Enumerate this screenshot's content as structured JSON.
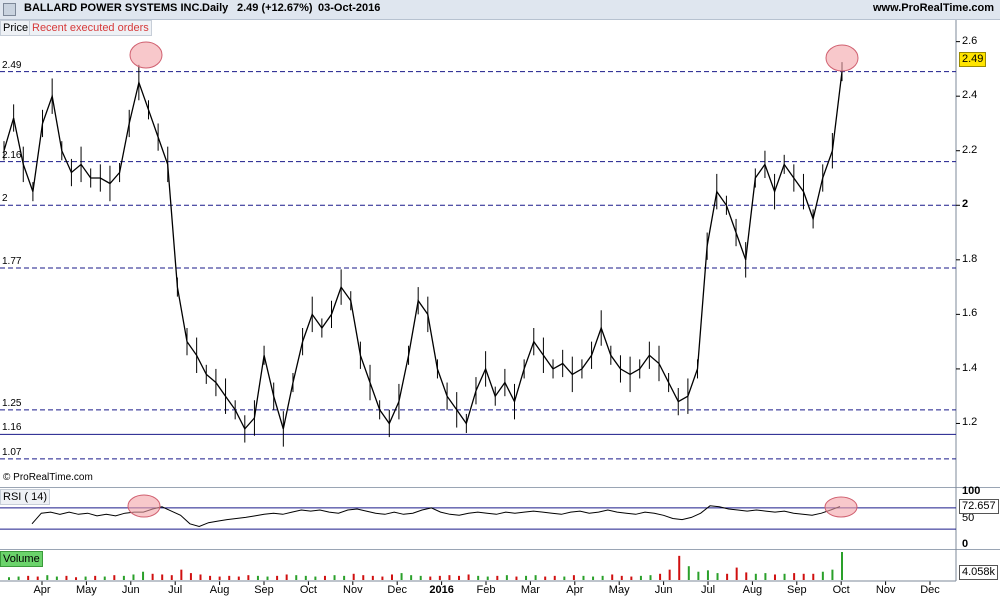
{
  "header": {
    "instrument": "BALLARD POWER SYSTEMS INC.",
    "period": "Daily",
    "quote": "2.49 (+12.67%)",
    "date": "03-Oct-2016",
    "brand": "www.ProRealTime.com"
  },
  "price_panel": {
    "label": "Price",
    "overlay_label": "Recent executed orders",
    "watermark": "© ProRealTime.com",
    "levels": [
      {
        "label": "2.49",
        "value": 2.49,
        "style": "dashed"
      },
      {
        "label": "2.16",
        "value": 2.16,
        "style": "dashed"
      },
      {
        "label": "2",
        "value": 2.0,
        "style": "dashed"
      },
      {
        "label": "1.77",
        "value": 1.77,
        "style": "dashed"
      },
      {
        "label": "1.25",
        "value": 1.25,
        "style": "dashed"
      },
      {
        "label": "1.16",
        "value": 1.16,
        "style": "solid"
      },
      {
        "label": "1.07",
        "value": 1.07,
        "style": "dashed"
      }
    ],
    "last_value": "2.49",
    "y_ticks": [
      "2.6",
      "2.4",
      "2.2",
      "2",
      "1.8",
      "1.6",
      "1.4",
      "1.2"
    ]
  },
  "rsi_panel": {
    "label": "RSI ( 14)",
    "value_label": "72.657",
    "y_ticks": [
      "100",
      "50",
      "0"
    ]
  },
  "volume_panel": {
    "label": "Volume",
    "value_label": "4.058k"
  },
  "x_axis": {
    "months": [
      "Apr",
      "May",
      "Jun",
      "Jul",
      "Aug",
      "Sep",
      "Oct",
      "Nov",
      "Dec",
      "2016",
      "Feb",
      "Mar",
      "Apr",
      "May",
      "Jun",
      "Jul",
      "Aug",
      "Sep",
      "Oct",
      "Nov",
      "Dec"
    ]
  },
  "colors": {
    "up": "#2aa02a",
    "down": "#d01010",
    "level_line": "#1a1a8a",
    "highlight": "#f4a3a8"
  },
  "chart_data": {
    "type": "line",
    "series": [
      {
        "name": "BALLARD POWER SYSTEMS INC.",
        "values": [
          2.2,
          2.32,
          2.15,
          2.05,
          2.3,
          2.4,
          2.2,
          2.12,
          2.15,
          2.1,
          2.1,
          2.08,
          2.12,
          2.3,
          2.45,
          2.35,
          2.25,
          2.15,
          1.7,
          1.5,
          1.45,
          1.38,
          1.35,
          1.3,
          1.25,
          1.18,
          1.22,
          1.45,
          1.3,
          1.18,
          1.35,
          1.5,
          1.6,
          1.55,
          1.6,
          1.7,
          1.65,
          1.45,
          1.35,
          1.25,
          1.2,
          1.28,
          1.45,
          1.65,
          1.6,
          1.4,
          1.3,
          1.25,
          1.2,
          1.32,
          1.4,
          1.3,
          1.35,
          1.28,
          1.4,
          1.5,
          1.45,
          1.4,
          1.42,
          1.38,
          1.4,
          1.45,
          1.55,
          1.45,
          1.4,
          1.38,
          1.4,
          1.45,
          1.42,
          1.35,
          1.28,
          1.3,
          1.4,
          1.85,
          2.05,
          2.0,
          1.9,
          1.8,
          2.1,
          2.15,
          2.05,
          2.15,
          2.1,
          2.05,
          1.95,
          2.1,
          2.2,
          2.49
        ]
      },
      {
        "name": "RSI ( 14)",
        "values": [
          40,
          60,
          62,
          58,
          62,
          58,
          60,
          55,
          58,
          55,
          60,
          62,
          62,
          68,
          72,
          64,
          56,
          40,
          35,
          42,
          45,
          48,
          50,
          52,
          55,
          58,
          60,
          58,
          62,
          66,
          64,
          66,
          62,
          60,
          66,
          68,
          64,
          60,
          58,
          62,
          58,
          60,
          66,
          70,
          62,
          58,
          56,
          60,
          62,
          60,
          58,
          62,
          60,
          62,
          64,
          62,
          60,
          58,
          62,
          64,
          60,
          62,
          66,
          62,
          60,
          58,
          62,
          60,
          56,
          50,
          48,
          52,
          60,
          74,
          72,
          68,
          66,
          64,
          66,
          64,
          62,
          64,
          60,
          58,
          56,
          60,
          66,
          72.657
        ]
      },
      {
        "name": "Volume",
        "values": [
          0.4,
          0.5,
          0.6,
          0.5,
          0.7,
          0.5,
          0.6,
          0.4,
          0.5,
          0.6,
          0.5,
          0.7,
          0.6,
          0.8,
          1.2,
          0.9,
          0.8,
          0.7,
          1.5,
          1.0,
          0.8,
          0.6,
          0.5,
          0.6,
          0.5,
          0.7,
          0.6,
          0.5,
          0.6,
          0.8,
          0.7,
          0.6,
          0.5,
          0.6,
          0.7,
          0.6,
          0.9,
          0.7,
          0.6,
          0.5,
          0.8,
          1.0,
          0.7,
          0.6,
          0.5,
          0.6,
          0.7,
          0.6,
          0.8,
          0.6,
          0.5,
          0.6,
          0.7,
          0.5,
          0.6,
          0.7,
          0.5,
          0.6,
          0.5,
          0.7,
          0.6,
          0.5,
          0.6,
          0.8,
          0.6,
          0.5,
          0.6,
          0.7,
          0.9,
          1.5,
          3.5,
          2.0,
          1.2,
          1.4,
          1.0,
          0.9,
          1.8,
          1.1,
          0.9,
          1.0,
          0.8,
          0.9,
          1.0,
          0.9,
          0.9,
          1.2,
          1.5,
          4.058
        ]
      }
    ],
    "ylim": [
      1.0,
      2.65
    ],
    "ylim_rsi": [
      0,
      100
    ],
    "grid": false
  }
}
